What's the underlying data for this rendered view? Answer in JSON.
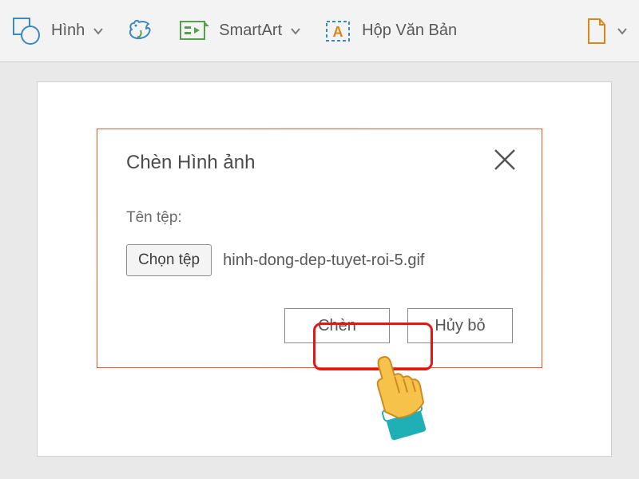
{
  "ribbon": {
    "shapes_label": "Hình",
    "smartart_label": "SmartArt",
    "textbox_label": "Hộp Văn Bản"
  },
  "dialog": {
    "title": "Chèn Hình ảnh",
    "file_label": "Tên tệp:",
    "choose_file": "Chọn tệp",
    "file_name": "hinh-dong-dep-tuyet-roi-5.gif",
    "insert": "Chèn",
    "cancel": "Hủy bỏ"
  },
  "colors": {
    "accent": "#ea5a2f",
    "highlight": "#e51616"
  }
}
